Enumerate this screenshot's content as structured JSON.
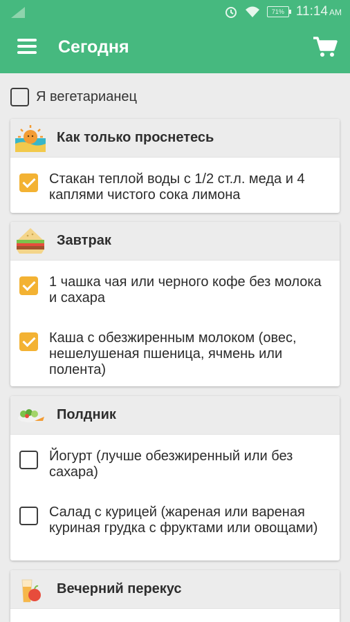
{
  "status_bar": {
    "time": "11:14",
    "ampm": "AM",
    "battery": "71%"
  },
  "app_bar": {
    "title": "Сегодня"
  },
  "vegetarian": {
    "label": "Я вегетарианец",
    "checked": false
  },
  "meals": [
    {
      "title": "Как только проснетесь",
      "icon": "sunrise-icon",
      "items": [
        {
          "text": "Стакан теплой воды с 1/2 ст.л. меда и 4 каплями чистого сока лимона",
          "checked": true
        }
      ]
    },
    {
      "title": "Завтрак",
      "icon": "sandwich-icon",
      "items": [
        {
          "text": "1 чашка чая или черного кофе без молока и сахара",
          "checked": true
        },
        {
          "text": "Каша с обезжиренным молоком (овес, нешелушеная пшеница, ячмень или полента)",
          "checked": true
        }
      ]
    },
    {
      "title": "Полдник",
      "icon": "salad-icon",
      "items": [
        {
          "text": "Йогурт (лучше обезжиренный или без сахара)",
          "checked": false
        },
        {
          "text": "Салад с курицей (жареная или вареная куриная грудка с фруктами или овощами)",
          "checked": false
        }
      ]
    },
    {
      "title": "Вечерний перекус",
      "icon": "juice-apple-icon",
      "items": []
    }
  ],
  "colors": {
    "primary": "#46b97f",
    "check": "#f3b233",
    "background": "#ececec"
  }
}
